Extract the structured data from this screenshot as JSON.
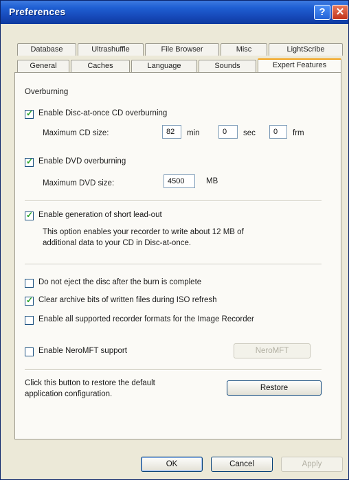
{
  "window": {
    "title": "Preferences",
    "help_glyph": "?",
    "close_glyph": "✕"
  },
  "tabs": {
    "back": [
      "Database",
      "Ultrashuffle",
      "File Browser",
      "Misc",
      "LightScribe"
    ],
    "front": [
      "General",
      "Caches",
      "Language",
      "Sounds",
      "Expert Features"
    ],
    "active": "Expert Features"
  },
  "overburning": {
    "group_label": "Overburning",
    "cd": {
      "label": "Enable Disc-at-once CD overburning",
      "checked": true,
      "max_label": "Maximum CD size:",
      "min": "82",
      "min_unit": "min",
      "sec": "0",
      "sec_unit": "sec",
      "frm": "0",
      "frm_unit": "frm"
    },
    "dvd": {
      "label": "Enable DVD overburning",
      "checked": true,
      "max_label": "Maximum DVD size:",
      "value": "4500",
      "unit": "MB"
    }
  },
  "short_leadout": {
    "label": "Enable generation of short lead-out",
    "checked": true,
    "description_line1": "This option enables your recorder to write about 12 MB of",
    "description_line2": "additional data to your CD in Disc-at-once."
  },
  "options": [
    {
      "label": "Do not eject the disc after the burn is complete",
      "checked": false
    },
    {
      "label": "Clear archive bits of written files during ISO refresh",
      "checked": true
    },
    {
      "label": "Enable all supported recorder formats for the Image Recorder",
      "checked": false
    },
    {
      "label": "Enable NeroMFT support",
      "checked": false
    }
  ],
  "neromft_button": "NeroMFT",
  "restore": {
    "text_line1": "Click this button to restore the default",
    "text_line2": "application configuration.",
    "button": "Restore"
  },
  "footer": {
    "ok": "OK",
    "cancel": "Cancel",
    "apply": "Apply"
  }
}
